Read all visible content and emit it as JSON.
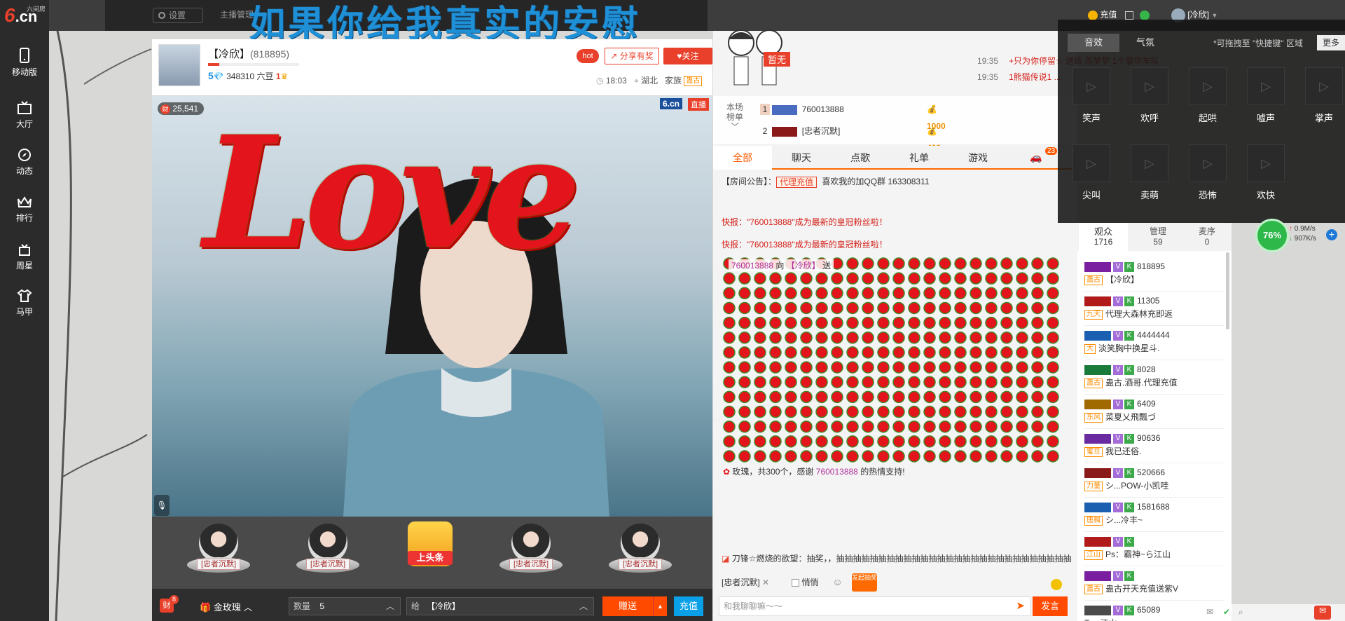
{
  "nav": {
    "logo_top": "六间房",
    "logo_main": "6",
    "logo_suffix": ".cn",
    "items": [
      {
        "label": "移动版",
        "icon": "phone-icon"
      },
      {
        "label": "大厅",
        "icon": "tv-icon"
      },
      {
        "label": "动态",
        "icon": "compass-icon"
      },
      {
        "label": "排行",
        "icon": "crown-icon"
      },
      {
        "label": "周星",
        "icon": "gift-box-icon"
      },
      {
        "label": "马甲",
        "icon": "shirt-icon"
      }
    ]
  },
  "topbar": {
    "settings": "设置",
    "anchor_center": "主播管理",
    "overlay_lyric": "如果你给我真实的安慰",
    "recharge": "充值",
    "username": "[冷欣]"
  },
  "anchor": {
    "name": "【冷欣】",
    "room_id": "(818895)",
    "level": "5",
    "beans": "348310 六豆",
    "fans_level": "1",
    "hot": "hot",
    "share": "分享有奖",
    "follow": "关注",
    "time": "18:03",
    "location": "湖北",
    "family_label": "家族",
    "family_tag": "蛊古",
    "wealth": "25,541",
    "brand": "6.cn",
    "live": "直播"
  },
  "guards": [
    "[忠者沉默]",
    "[忠者沉默]",
    "[忠者沉默]",
    "[忠者沉默]"
  ],
  "headline": "上头条",
  "gift_bar": {
    "wealth_badge": "财",
    "wealth_count": "8",
    "gift_name": "金玫瑰",
    "qty_label": "数量",
    "qty": "5",
    "to_label": "给",
    "to": "【冷欣】",
    "send": "赠送",
    "recharge": "充值"
  },
  "overlay": {
    "love_text": "Love",
    "none_tag": "暂无"
  },
  "announcements": [
    {
      "time": "19:35",
      "text": "+只为你停留☆ 送给 燕梦梦 1个豪华车队"
    },
    {
      "time": "19:35",
      "text": "1熊猫传说1 ..."
    }
  ],
  "rank": {
    "label": "本场榜单",
    "rows": [
      {
        "no": "1",
        "name": "760013888",
        "score": "1000"
      },
      {
        "no": "2",
        "name": "[忠者沉默]",
        "score": "400"
      }
    ]
  },
  "chat_tabs": [
    "全部",
    "聊天",
    "点歌",
    "礼单",
    "游戏"
  ],
  "car_count": "23",
  "notice": {
    "prefix": "【房间公告】：",
    "tag": "代理充值",
    "text": "喜欢我的加QQ群 163308311"
  },
  "system_msgs": [
    "快报：\"760013888\"成为最新的皇冠粉丝啦！",
    "快报：\"760013888\"成为最新的皇冠粉丝啦！"
  ],
  "gift_msg": {
    "user": "760013888",
    "verb": "向",
    "target": "【冷欣】",
    "send": "送"
  },
  "thanks_msg": {
    "prefix": "玫瑰，共300个，感谢",
    "user": "760013888",
    "suffix": "的热情支持!"
  },
  "lottery_msg": "刀锋☆燃烧的欲望：抽奖，，抽抽抽抽抽抽抽抽抽抽抽抽抽抽抽抽抽抽抽抽抽抽抽抽抽抽抽抽",
  "chat_input": {
    "target": "[忠者沉默]",
    "quiet": "悄悄",
    "red_pack": "发起抽奖",
    "placeholder": "和我聊聊嘛～～",
    "speak": "发言"
  },
  "sfx": {
    "tabs": [
      "音效",
      "气氛"
    ],
    "hint": "*可拖拽至 \"快捷键\" 区域",
    "more": "更多",
    "items": [
      "笑声",
      "欢呼",
      "起哄",
      "嘘声",
      "掌声",
      "尖叫",
      "卖萌",
      "恐怖",
      "欢快"
    ]
  },
  "audience": {
    "tabs": [
      {
        "label": "观众",
        "count": "1716"
      },
      {
        "label": "管理",
        "count": "59"
      },
      {
        "label": "麦序",
        "count": "0"
      }
    ],
    "rows": [
      {
        "id": "818895",
        "tag": "蛊古",
        "name": "【冷欣】"
      },
      {
        "id": "11305",
        "tag": "九天",
        "name": "代理大森林充即返"
      },
      {
        "id": "4444444",
        "tag": "大",
        "name": "淡笑胸中换星斗."
      },
      {
        "id": "8028",
        "tag": "蛊古",
        "name": "蛊古.酒哥.代理充值"
      },
      {
        "id": "6409",
        "tag": "东风",
        "name": "菜夏乂飛飄づ"
      },
      {
        "id": "90636",
        "tag": "蜜豆",
        "name": "我已还俗."
      },
      {
        "id": "520666",
        "tag": "力量",
        "name": "シ...POW-小凯哇"
      },
      {
        "id": "1581688",
        "tag": "唐楓",
        "name": "シ...冷丰~"
      },
      {
        "id": "",
        "tag": "江山",
        "name": "Ps：霸神~ら江山"
      },
      {
        "id": "",
        "tag": "蛊古",
        "name": "蛊古开天充值送紫V"
      },
      {
        "id": "65089",
        "tag": "",
        "name": "Ta...江山"
      }
    ]
  },
  "speed": {
    "percent": "76%",
    "up": "0.9M/s",
    "down": "907K/s"
  },
  "colors": {
    "accent": "#ff5a00",
    "brand_red": "#e8402a",
    "nav_bg": "#2b2b2b",
    "recharge_blue": "#0aa0e8"
  }
}
